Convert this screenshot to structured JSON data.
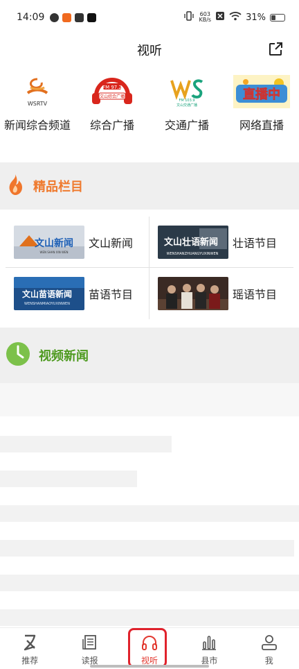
{
  "status": {
    "time": "14:09",
    "net_speed_value": "603",
    "net_speed_unit": "KB/s",
    "battery": "31%"
  },
  "header": {
    "title": "视听"
  },
  "channels": [
    {
      "label": "新闻综合频道",
      "logo_text": "WSRTV"
    },
    {
      "label": "综合广播",
      "logo_text": "FM 97.2 文山综合广播"
    },
    {
      "label": "交通广播",
      "logo_text": "WS FM 103.9 文山交通广播"
    },
    {
      "label": "网络直播",
      "logo_text": "直播中"
    }
  ],
  "sections": {
    "premium": {
      "title": "精品栏目",
      "color": "#ef7a2e"
    },
    "video": {
      "title": "视频新闻",
      "color": "#4d9a1f"
    }
  },
  "programs": [
    {
      "label": "文山新闻",
      "thumb_text": "文山新闻",
      "thumb_sub": "WEN SHAN XIN WEN"
    },
    {
      "label": "壮语节目",
      "thumb_text": "文山壮语新闻",
      "thumb_sub": "WENSHANZHUANGYUXINWEN"
    },
    {
      "label": "苗语节目",
      "thumb_text": "文山苗语新闻",
      "thumb_sub": "WENSHANMIAOYUXINWEN"
    },
    {
      "label": "瑶语节目",
      "thumb_text": "",
      "thumb_sub": ""
    }
  ],
  "nav": [
    {
      "label": "推荐",
      "icon": "recommend-icon"
    },
    {
      "label": "读报",
      "icon": "newspaper-icon"
    },
    {
      "label": "视听",
      "icon": "headphones-icon",
      "active": true
    },
    {
      "label": "县市",
      "icon": "bar-chart-icon"
    },
    {
      "label": "我",
      "icon": "person-icon"
    }
  ]
}
